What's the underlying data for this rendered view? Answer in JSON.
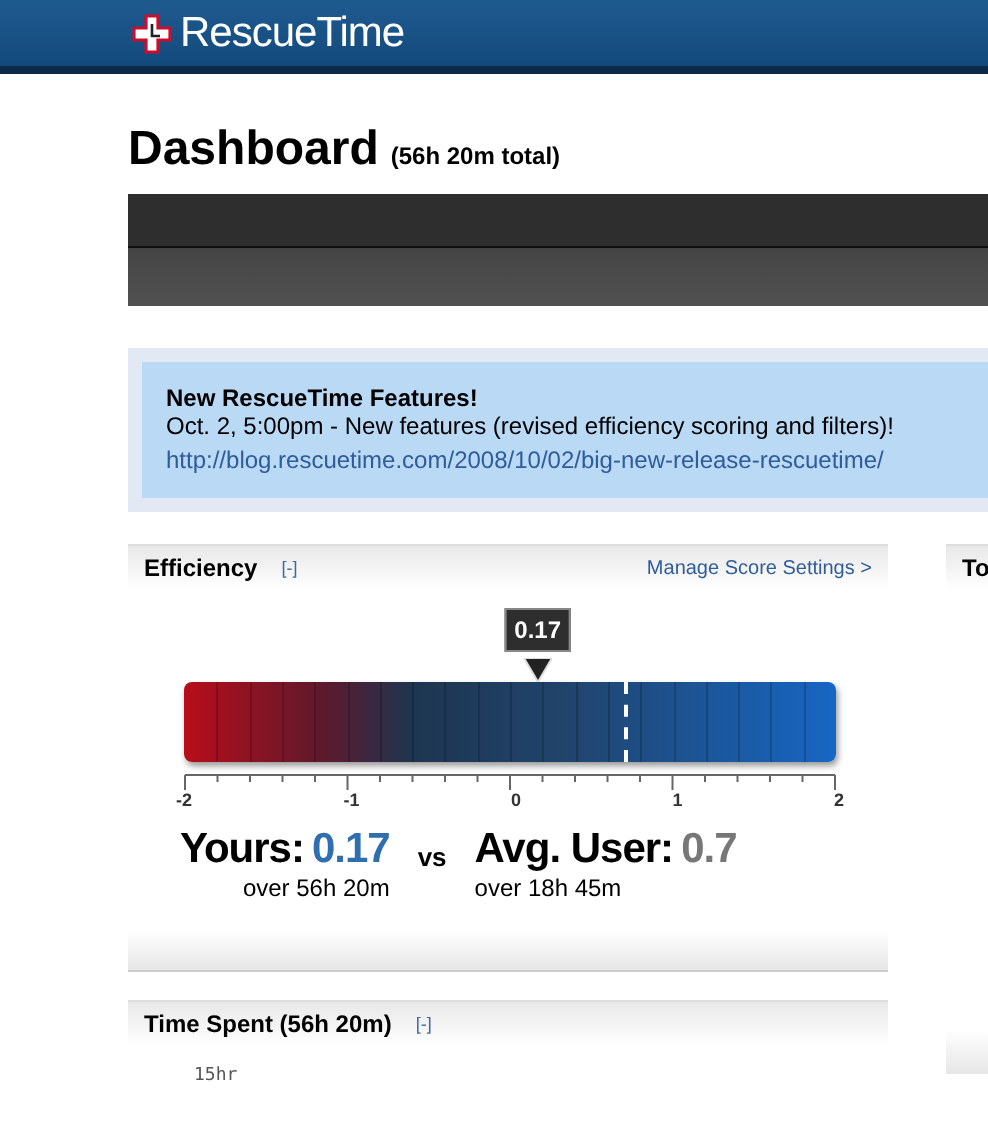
{
  "header": {
    "logo_text": "RescueTime"
  },
  "page": {
    "title": "Dashboard",
    "subtitle": "(56h 20m total)"
  },
  "notice": {
    "title": "New RescueTime Features!",
    "text": "Oct. 2, 5:00pm - New features (revised efficiency scoring and filters)!",
    "link": "http://blog.rescuetime.com/2008/10/02/big-new-release-rescuetime/"
  },
  "efficiency": {
    "title": "Efficiency",
    "toggle": "[-]",
    "settings_link": "Manage Score Settings >",
    "marker": {
      "label": "0.17",
      "level": 0.5425
    },
    "average_line": {
      "level": 0.675
    },
    "axis_labels": [
      "-2",
      "-1",
      "0",
      "1",
      "2"
    ],
    "yours": {
      "label": "Yours:",
      "value": "0.17",
      "detail": "over 56h 20m"
    },
    "vs": "vs",
    "average": {
      "label": "Avg. User:",
      "value": "0.7",
      "detail": "over 18h 45m"
    }
  },
  "time_spent": {
    "title": "Time Spent (56h 20m)",
    "toggle": "[-]",
    "axis_label": "15hr"
  },
  "side_panel": {
    "title": "To"
  }
}
